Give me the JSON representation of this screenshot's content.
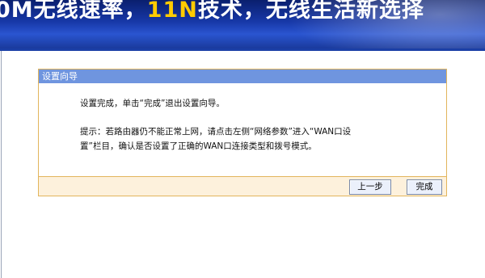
{
  "banner": {
    "text_prefix": "0M无线速率，",
    "text_highlight": "11N",
    "text_suffix": "技术，无线生活新选择"
  },
  "dialog": {
    "title": "设置向导",
    "message": "设置完成，单击“完成”退出设置向导。",
    "hint_line1": "提示：若路由器仍不能正常上网，请点击左侧“网络参数”进入“WAN口设",
    "hint_line2": "置”栏目，确认是否设置了正确的WAN口连接类型和拨号模式。",
    "back_button": "上一步",
    "finish_button": "完成"
  }
}
